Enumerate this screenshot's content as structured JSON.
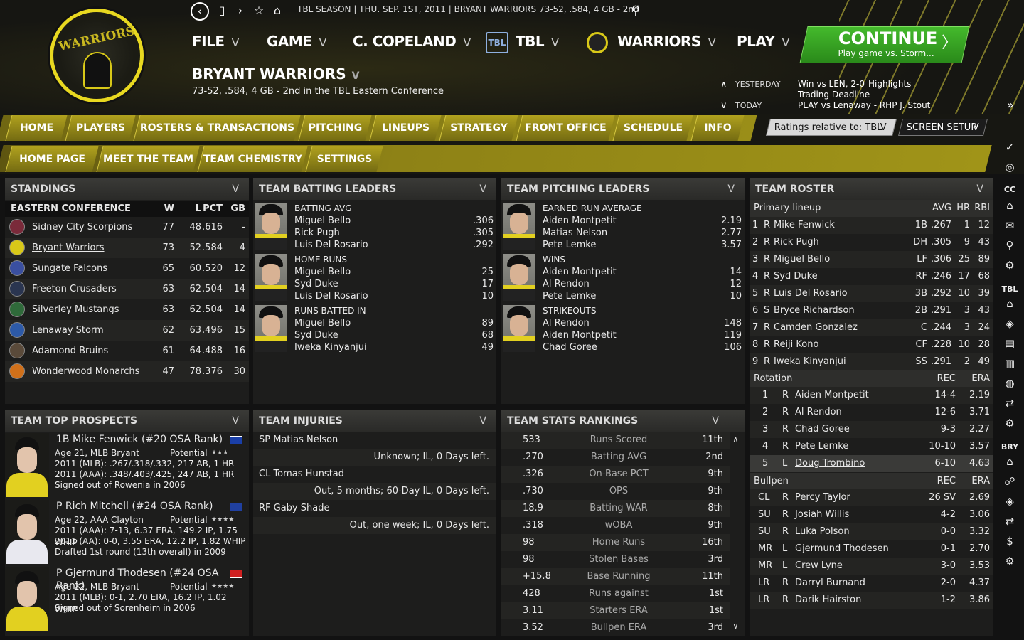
{
  "topbar": {
    "text": "TBL SEASON | THU. SEP. 1ST, 2011 | BRYANT WARRIORS 73-52, .584, 4 GB - 2nd"
  },
  "nav_icons": [
    "back-icon",
    "tablet-icon",
    "forward-icon",
    "star-icon",
    "home-icon",
    "search-icon"
  ],
  "menu": {
    "file": "FILE",
    "game": "GAME",
    "manager": "C. COPELAND",
    "league": "TBL",
    "team": "WARRIORS",
    "play": "PLAY"
  },
  "logo_text": "WARRIORS",
  "team": {
    "name": "BRYANT WARRIORS",
    "record": "73-52, .584, 4 GB - 2nd in the TBL Eastern Conference"
  },
  "continue": {
    "label": "CONTINUE",
    "sub": "Play game vs. Storm..."
  },
  "news": {
    "yesterday_label": "YESTERDAY",
    "today_label": "TODAY",
    "line1": "Win vs LEN, 2-0",
    "line1_link": "Highlights",
    "line2": "Trading Deadline",
    "line3": "PLAY vs Lenaway - RHP J. Stout"
  },
  "tabs_main": [
    "HOME",
    "PLAYERS",
    "ROSTERS & TRANSACTIONS",
    "PITCHING",
    "LINEUPS",
    "STRATEGY",
    "FRONT OFFICE",
    "SCHEDULE",
    "INFO"
  ],
  "tabs_sub": [
    "HOME PAGE",
    "MEET THE TEAM",
    "TEAM CHEMISTRY",
    "SETTINGS"
  ],
  "ratings_dropdown": "Ratings relative to: TBL",
  "screen_setup": "SCREEN SETUP",
  "standings": {
    "title": "STANDINGS",
    "conference": "EASTERN CONFERENCE",
    "cols": [
      "W",
      "L",
      "PCT",
      "GB"
    ],
    "rows": [
      {
        "team": "Sidney City Scorpions",
        "w": "77",
        "l": "48",
        "pct": ".616",
        "gb": "-",
        "color": "#7a2a3a"
      },
      {
        "team": "Bryant Warriors",
        "w": "73",
        "l": "52",
        "pct": ".584",
        "gb": "4",
        "color": "#d8c818"
      },
      {
        "team": "Sungate Falcons",
        "w": "65",
        "l": "60",
        "pct": ".520",
        "gb": "12",
        "color": "#3a4fa0"
      },
      {
        "team": "Freeton Crusaders",
        "w": "63",
        "l": "62",
        "pct": ".504",
        "gb": "14",
        "color": "#2a3550"
      },
      {
        "team": "Silverley Mustangs",
        "w": "63",
        "l": "62",
        "pct": ".504",
        "gb": "14",
        "color": "#2f6a3a"
      },
      {
        "team": "Lenaway Storm",
        "w": "62",
        "l": "63",
        "pct": ".496",
        "gb": "15",
        "color": "#2d5aa8"
      },
      {
        "team": "Adamond Bruins",
        "w": "61",
        "l": "64",
        "pct": ".488",
        "gb": "16",
        "color": "#5a4a3a"
      },
      {
        "team": "Wonderwood Monarchs",
        "w": "47",
        "l": "78",
        "pct": ".376",
        "gb": "30",
        "color": "#d0701a"
      }
    ]
  },
  "batting_leaders": {
    "title": "TEAM BATTING LEADERS",
    "groups": [
      {
        "cat": "BATTING AVG",
        "players": [
          {
            "n": "Miguel Bello",
            "v": ".306"
          },
          {
            "n": "Rick Pugh",
            "v": ".305"
          },
          {
            "n": "Luis Del Rosario",
            "v": ".292"
          }
        ]
      },
      {
        "cat": "HOME RUNS",
        "players": [
          {
            "n": "Miguel Bello",
            "v": "25"
          },
          {
            "n": "Syd Duke",
            "v": "17"
          },
          {
            "n": "Luis Del Rosario",
            "v": "10"
          }
        ]
      },
      {
        "cat": "RUNS BATTED IN",
        "players": [
          {
            "n": "Miguel Bello",
            "v": "89"
          },
          {
            "n": "Syd Duke",
            "v": "68"
          },
          {
            "n": "Iweka Kinyanjui",
            "v": "49"
          }
        ]
      }
    ]
  },
  "pitching_leaders": {
    "title": "TEAM PITCHING LEADERS",
    "groups": [
      {
        "cat": "EARNED RUN AVERAGE",
        "players": [
          {
            "n": "Aiden Montpetit",
            "v": "2.19"
          },
          {
            "n": "Matias Nelson",
            "v": "2.77"
          },
          {
            "n": "Pete Lemke",
            "v": "3.57"
          }
        ]
      },
      {
        "cat": "WINS",
        "players": [
          {
            "n": "Aiden Montpetit",
            "v": "14"
          },
          {
            "n": "Al Rendon",
            "v": "12"
          },
          {
            "n": "Pete Lemke",
            "v": "10"
          }
        ]
      },
      {
        "cat": "STRIKEOUTS",
        "players": [
          {
            "n": "Al Rendon",
            "v": "148"
          },
          {
            "n": "Aiden Montpetit",
            "v": "119"
          },
          {
            "n": "Chad Goree",
            "v": "106"
          }
        ]
      }
    ]
  },
  "roster": {
    "title": "TEAM ROSTER",
    "lineup_label": "Primary lineup",
    "lineup_cols": [
      "AVG",
      "HR",
      "RBI"
    ],
    "lineup": [
      {
        "n": "1",
        "h": "R",
        "name": "Mike Fenwick",
        "pos": "1B",
        "avg": ".267",
        "hr": "1",
        "rbi": "12"
      },
      {
        "n": "2",
        "h": "R",
        "name": "Rick Pugh",
        "pos": "DH",
        "avg": ".305",
        "hr": "9",
        "rbi": "43"
      },
      {
        "n": "3",
        "h": "R",
        "name": "Miguel Bello",
        "pos": "LF",
        "avg": ".306",
        "hr": "25",
        "rbi": "89"
      },
      {
        "n": "4",
        "h": "R",
        "name": "Syd Duke",
        "pos": "RF",
        "avg": ".246",
        "hr": "17",
        "rbi": "68"
      },
      {
        "n": "5",
        "h": "R",
        "name": "Luis Del Rosario",
        "pos": "3B",
        "avg": ".292",
        "hr": "10",
        "rbi": "39"
      },
      {
        "n": "6",
        "h": "S",
        "name": "Bryce Richardson",
        "pos": "2B",
        "avg": ".291",
        "hr": "3",
        "rbi": "43"
      },
      {
        "n": "7",
        "h": "R",
        "name": "Camden Gonzalez",
        "pos": "C",
        "avg": ".244",
        "hr": "3",
        "rbi": "24"
      },
      {
        "n": "8",
        "h": "R",
        "name": "Reiji Kono",
        "pos": "CF",
        "avg": ".228",
        "hr": "10",
        "rbi": "28"
      },
      {
        "n": "9",
        "h": "R",
        "name": "Iweka Kinyanjui",
        "pos": "SS",
        "avg": ".291",
        "hr": "2",
        "rbi": "49"
      }
    ],
    "rotation_label": "Rotation",
    "rot_cols": [
      "REC",
      "ERA"
    ],
    "rotation": [
      {
        "n": "1",
        "h": "R",
        "name": "Aiden Montpetit",
        "rec": "14-4",
        "era": "2.19"
      },
      {
        "n": "2",
        "h": "R",
        "name": "Al Rendon",
        "rec": "12-6",
        "era": "3.71"
      },
      {
        "n": "3",
        "h": "R",
        "name": "Chad Goree",
        "rec": "9-3",
        "era": "2.27"
      },
      {
        "n": "4",
        "h": "R",
        "name": "Pete Lemke",
        "rec": "10-10",
        "era": "3.57"
      },
      {
        "n": "5",
        "h": "L",
        "name": "Doug Trombino",
        "rec": "6-10",
        "era": "4.63"
      }
    ],
    "bullpen_label": "Bullpen",
    "bullpen": [
      {
        "n": "CL",
        "h": "R",
        "name": "Percy Taylor",
        "rec": "26 SV",
        "era": "2.69"
      },
      {
        "n": "SU",
        "h": "R",
        "name": "Josiah Willis",
        "rec": "4-2",
        "era": "3.06"
      },
      {
        "n": "SU",
        "h": "R",
        "name": "Luka Polson",
        "rec": "0-0",
        "era": "3.32"
      },
      {
        "n": "MR",
        "h": "L",
        "name": "Gjermund Thodesen",
        "rec": "0-1",
        "era": "2.70"
      },
      {
        "n": "MR",
        "h": "L",
        "name": "Crew Lyne",
        "rec": "3-0",
        "era": "3.53"
      },
      {
        "n": "LR",
        "h": "R",
        "name": "Darryl Burnand",
        "rec": "2-0",
        "era": "4.37"
      },
      {
        "n": "LR",
        "h": "R",
        "name": "Darik Hairston",
        "rec": "1-2",
        "era": "3.86"
      }
    ]
  },
  "prospects": {
    "title": "TEAM TOP PROSPECTS",
    "potential_label": "Potential",
    "items": [
      {
        "title": "1B Mike Fenwick (#20 OSA Rank)",
        "age": "Age 21, MLB Bryant",
        "stars": "★★★",
        "l1": "2011 (MLB): .267/.318/.332, 217 AB, 1 HR",
        "l2": "2011 (AAA): .348/.403/.425, 247 AB, 1 HR",
        "l3": "Signed out of Rowenia in 2006",
        "jersey": "#e2d020"
      },
      {
        "title": "P Rich Mitchell (#24 OSA Rank)",
        "age": "Age 22, AAA Clayton",
        "stars": "★★★★",
        "l1": "2011 (AAA): 7-13, 6.37 ERA, 149.2 IP, 1.75 WHIP",
        "l2": "2011 (AA): 0-0, 3.55 ERA, 12.2 IP, 1.82 WHIP",
        "l3": "Drafted 1st round (13th overall) in 2009",
        "jersey": "#e8e8ef"
      },
      {
        "title": "P Gjermund Thodesen (#24 OSA Rank)",
        "age": "Age 22, MLB Bryant",
        "stars": "★★★★",
        "l1": "2011 (MLB): 0-1, 2.70 ERA, 16.2 IP, 1.02 WHIP",
        "l2": "Signed out of Sorenheim in 2006",
        "l3": "",
        "jersey": "#e2d020"
      }
    ]
  },
  "injuries": {
    "title": "TEAM INJURIES",
    "items": [
      {
        "who": "SP Matias Nelson",
        "what": "Unknown; IL, 0 Days left."
      },
      {
        "who": "CL Tomas Hunstad",
        "what": "Out, 5 months; 60-Day IL, 0 Days left."
      },
      {
        "who": "RF Gaby Shade",
        "what": "Out, one week; IL, 0 Days left."
      }
    ]
  },
  "rankings": {
    "title": "TEAM STATS RANKINGS",
    "items": [
      {
        "v": "533",
        "s": "Runs Scored",
        "r": "11th"
      },
      {
        "v": ".270",
        "s": "Batting AVG",
        "r": "2nd"
      },
      {
        "v": ".326",
        "s": "On-Base PCT",
        "r": "9th"
      },
      {
        "v": ".730",
        "s": "OPS",
        "r": "9th"
      },
      {
        "v": "18.9",
        "s": "Batting WAR",
        "r": "8th"
      },
      {
        "v": ".318",
        "s": "wOBA",
        "r": "9th"
      },
      {
        "v": "98",
        "s": "Home Runs",
        "r": "16th"
      },
      {
        "v": "98",
        "s": "Stolen Bases",
        "r": "3rd"
      },
      {
        "v": "+15.8",
        "s": "Base Running",
        "r": "11th"
      },
      {
        "v": "428",
        "s": "Runs against",
        "r": "1st"
      },
      {
        "v": "3.11",
        "s": "Starters ERA",
        "r": "1st"
      },
      {
        "v": "3.52",
        "s": "Bullpen ERA",
        "r": "3rd"
      }
    ]
  },
  "sidebar": {
    "cc": "CC",
    "tbl": "TBL",
    "bry": "BRY"
  }
}
